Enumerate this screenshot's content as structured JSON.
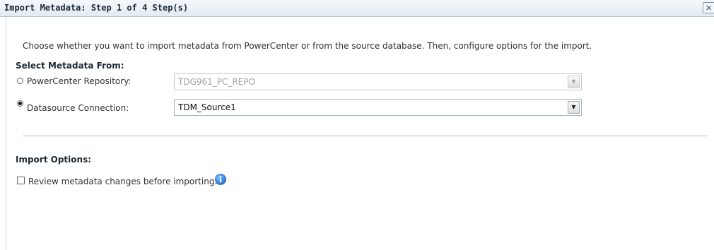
{
  "dialog": {
    "title": "Import Metadata: Step 1 of 4 Step(s)",
    "close_icon_glyph": "×",
    "close_icon": "close-icon"
  },
  "content": {
    "instruction": "Choose whether you want to import metadata from PowerCenter or from the source database. Then, configure options for the import.",
    "select_heading": "Select Metadata From:",
    "options": [
      {
        "label": "PowerCenter Repository:",
        "selected": false,
        "value": "TDG961_PC_REPO",
        "enabled": false
      },
      {
        "label": "Datasource Connection:",
        "selected": true,
        "value": "TDM_Source1",
        "enabled": true
      }
    ],
    "import_options_heading": "Import Options:",
    "review_checkbox": {
      "label": "Review metadata changes before importing.",
      "checked": false
    },
    "info_icon": "info-icon"
  },
  "colors": {
    "accent": "#2c7fd6",
    "titlebar": "#e8eef4",
    "divider": "#a9bdd0"
  }
}
